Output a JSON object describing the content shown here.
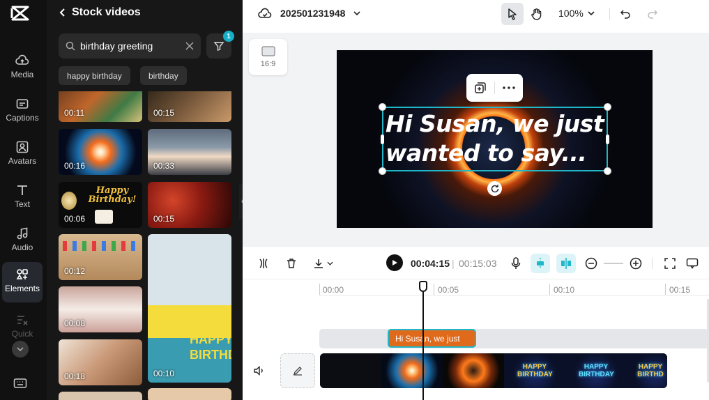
{
  "rail": {
    "items": [
      {
        "label": "Media",
        "icon": "cloud-upload-icon"
      },
      {
        "label": "Captions",
        "icon": "captions-icon"
      },
      {
        "label": "Avatars",
        "icon": "avatar-icon"
      },
      {
        "label": "Text",
        "icon": "text-icon"
      },
      {
        "label": "Audio",
        "icon": "music-note-icon"
      },
      {
        "label": "Elements",
        "icon": "elements-icon"
      },
      {
        "label": "Quick",
        "icon": "quick-tools-icon"
      }
    ],
    "active": "Elements"
  },
  "panel": {
    "title": "Stock videos",
    "search_value": "birthday greeting",
    "filter_count": "1",
    "chips": [
      "happy birthday",
      "birthday"
    ],
    "videos": [
      {
        "duration": "00:11"
      },
      {
        "duration": "00:15"
      },
      {
        "duration": "00:16"
      },
      {
        "duration": "00:33"
      },
      {
        "duration": "00:06",
        "caption": "Happy Birthday!"
      },
      {
        "duration": "00:15"
      },
      {
        "duration": "00:12"
      },
      {
        "duration": "00:10",
        "caption": "HAPPY BIRTHDAY"
      },
      {
        "duration": "00:08"
      },
      {
        "duration": "00:18"
      }
    ]
  },
  "header": {
    "project_name": "202501231948",
    "zoom": "100%"
  },
  "canvas": {
    "aspect_ratio": "16:9",
    "caption": "Hi Susan, we just wanted to say..."
  },
  "player": {
    "current_time": "00:04:15",
    "separator": "|",
    "total_time": "00:15:03"
  },
  "timeline": {
    "ruler": [
      "00:00",
      "00:05",
      "00:10",
      "00:15"
    ],
    "text_clip": "Hi Susan, we just",
    "video_frame_labels": [
      "HAPPY BIRTHDAY",
      "HAPPY BIRTHDAY",
      "HAPPY BIRTHD"
    ]
  },
  "colors": {
    "accent": "#20b7c9",
    "text_clip": "#e06a1c",
    "rail_bg": "#111111",
    "panel_bg": "#171717"
  }
}
